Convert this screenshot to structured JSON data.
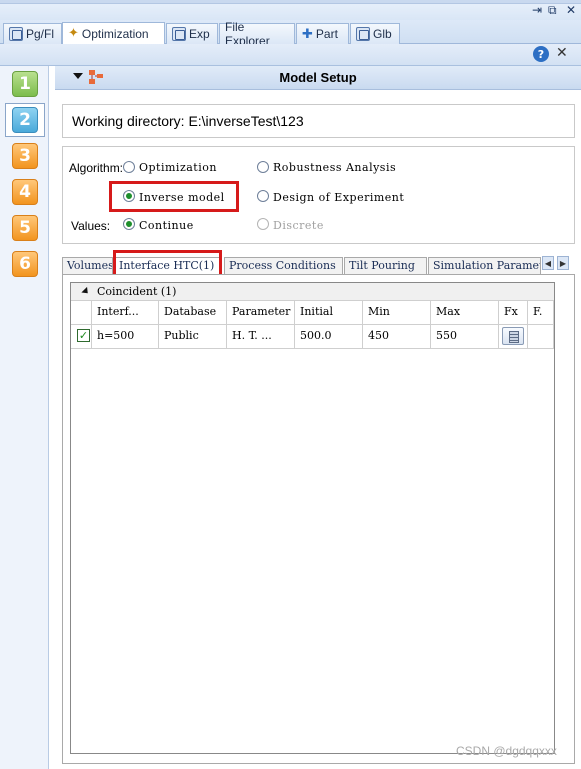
{
  "panel_tabs": [
    {
      "label": "Pg/Fl",
      "icon": "pgfl-icon"
    },
    {
      "label": "Optimization",
      "icon": "wand-icon",
      "active": true
    },
    {
      "label": "Exp",
      "icon": "exp-icon"
    },
    {
      "label": "File Explorer",
      "icon": "none"
    },
    {
      "label": "Part",
      "icon": "puzzle-icon"
    },
    {
      "label": "Glb",
      "icon": "glb-icon"
    }
  ],
  "window_controls": {
    "pin": "⇥",
    "restore": "⧉",
    "close": "✕"
  },
  "toolbar": {
    "help": "?",
    "close": "✕"
  },
  "steps": [
    "1",
    "2",
    "3",
    "4",
    "5",
    "6"
  ],
  "header": {
    "title": "Model Setup"
  },
  "working_directory": "Working directory: E:\\inverseTest\\123",
  "algorithm": {
    "label": "Algorithm:",
    "options": [
      "Optimization",
      "Robustness Analysis",
      "Inverse model",
      "Design of Experiment"
    ],
    "selected": "Inverse model"
  },
  "values": {
    "label": "Values:",
    "options": [
      "Continue",
      "Discrete"
    ],
    "selected": "Continue"
  },
  "sub_tabs": [
    "Volumes",
    "Interface HTC(1)",
    "Process Conditions",
    "Tilt Pouring",
    "Simulation Paramet"
  ],
  "active_sub_tab": "Interface HTC(1)",
  "scroll": {
    "left": "◀",
    "right": "▶"
  },
  "table": {
    "group": "Coincident (1)",
    "columns": [
      "Interf...",
      "Database",
      "Parameter",
      "Initial",
      "Min",
      "Max",
      "Fx",
      "F."
    ],
    "rows": [
      {
        "checked": "✓",
        "cells": [
          "h=500",
          "Public",
          "H. T. ...",
          "500.0",
          "450",
          "550"
        ]
      }
    ]
  },
  "watermark": "CSDN @dgdqqxxx",
  "colors": {
    "highlight": "#d61a1a",
    "radio_on": "#1e8f2d",
    "accent": "#2d6fc4"
  }
}
